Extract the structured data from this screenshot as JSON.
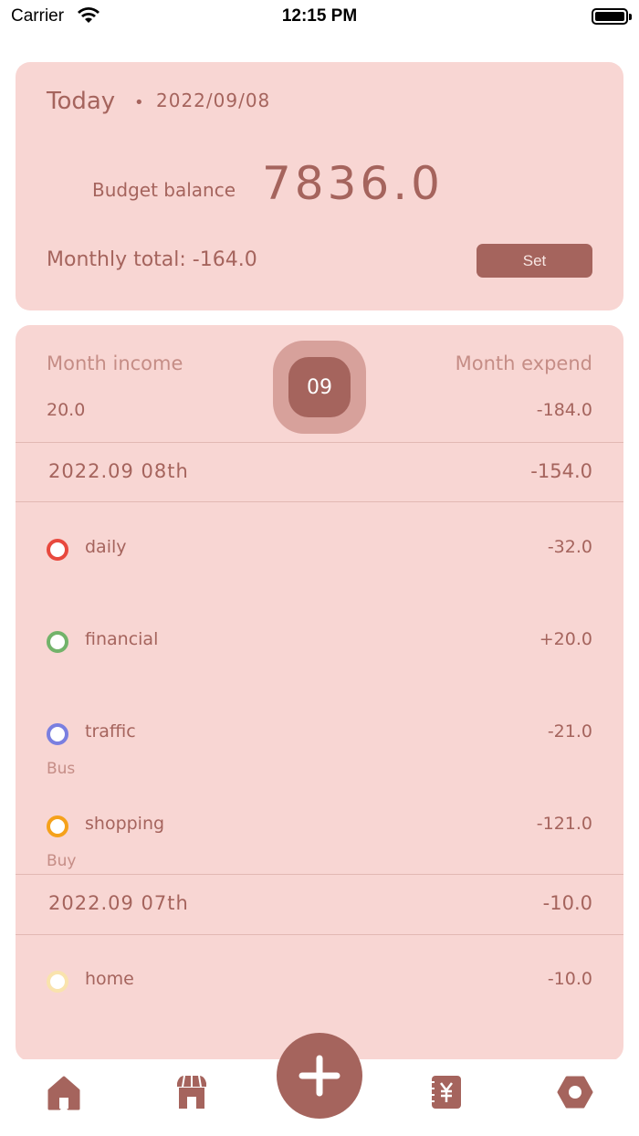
{
  "status": {
    "carrier": "Carrier",
    "time": "12:15 PM"
  },
  "summary": {
    "today_label": "Today",
    "dot": "•",
    "date": "2022/09/08",
    "budget_label": "Budget balance",
    "budget_value": "7836.0",
    "monthly_total": "Monthly total: -164.0",
    "set_label": "Set"
  },
  "month": {
    "income_label": "Month income",
    "income_value": "20.0",
    "expend_label": "Month expend",
    "expend_value": "-184.0",
    "badge": "09"
  },
  "days": [
    {
      "date": "2022.09 08th",
      "total": "-154.0",
      "entries": [
        {
          "category": "daily",
          "amount": "-32.0",
          "note": "",
          "color": "#e8493e"
        },
        {
          "category": "financial",
          "amount": "+20.0",
          "note": "",
          "color": "#72b36a"
        },
        {
          "category": "traffic",
          "amount": "-21.0",
          "note": "Bus",
          "color": "#7a7fe0"
        },
        {
          "category": "shopping",
          "amount": "-121.0",
          "note": "Buy",
          "color": "#f5a11b"
        }
      ]
    },
    {
      "date": "2022.09 07th",
      "total": "-10.0",
      "entries": [
        {
          "category": "home",
          "amount": "-10.0",
          "note": "",
          "color": "#f9e3ad"
        }
      ]
    }
  ],
  "tabs": {
    "home_icon": "home-icon",
    "store_icon": "store-icon",
    "add_icon": "plus-icon",
    "ledger_icon": "yen-book-icon",
    "settings_icon": "hexagon-settings-icon"
  },
  "colors": {
    "accent": "#a5645d",
    "card": "#f8d6d3"
  }
}
